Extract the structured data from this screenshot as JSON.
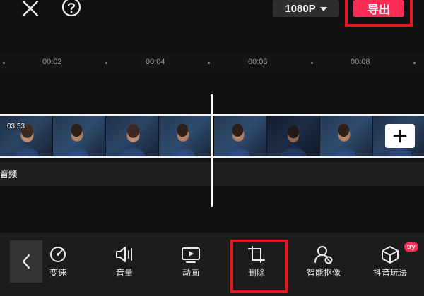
{
  "topbar": {
    "close_icon": "close-icon",
    "help_icon": "help-icon",
    "resolution": "1080P",
    "export_label": "导出",
    "export_color": "#fe2c55",
    "highlight_color": "#e8161d"
  },
  "ruler": {
    "labels": [
      "00:02",
      "00:04",
      "00:06",
      "00:08"
    ]
  },
  "timeline": {
    "clip_duration": "03:53",
    "audio_track_label": "音频",
    "add_clip_icon": "plus-icon"
  },
  "toolbar": {
    "back_icon": "chevron-left-icon",
    "items": [
      {
        "label": "变速",
        "icon": "speed-icon"
      },
      {
        "label": "音量",
        "icon": "volume-icon"
      },
      {
        "label": "动画",
        "icon": "animation-icon"
      },
      {
        "label": "删除",
        "icon": "crop-delete-icon"
      },
      {
        "label": "智能抠像",
        "icon": "smart-cutout-icon"
      },
      {
        "label": "抖音玩法",
        "icon": "cube-icon"
      }
    ],
    "try_badge": "try"
  }
}
